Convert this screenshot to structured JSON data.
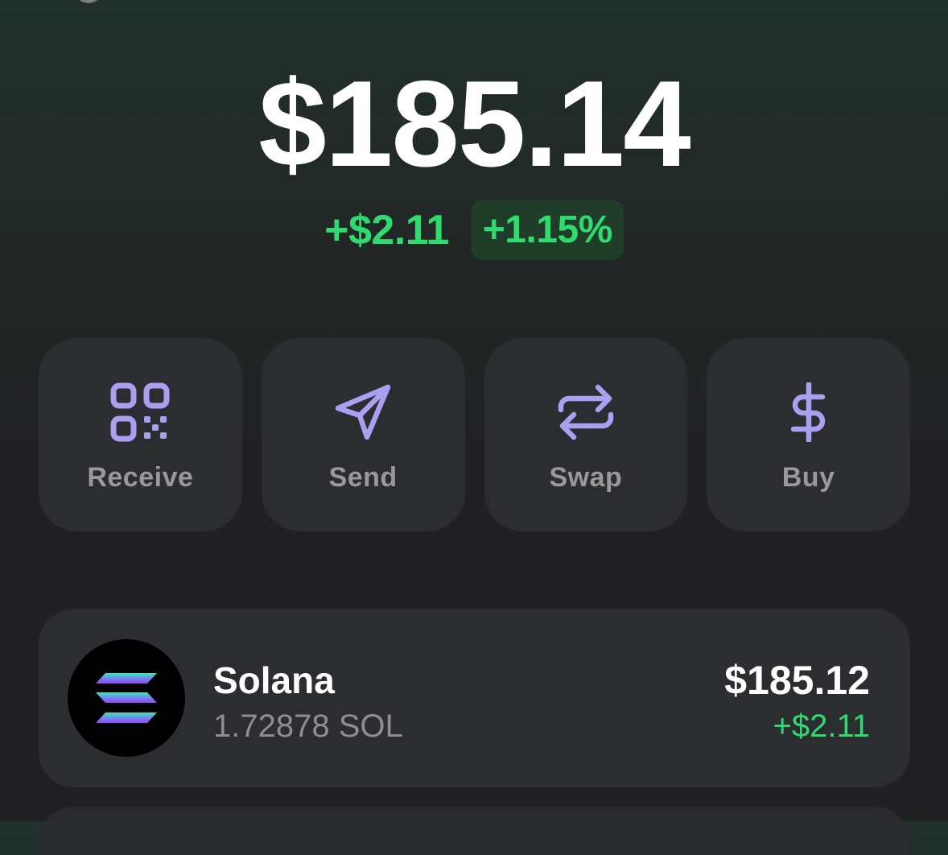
{
  "portfolio": {
    "balance": "$185.14",
    "change_amount": "+$2.11",
    "change_percent": "+1.15%"
  },
  "actions": [
    {
      "label": "Receive",
      "icon": "qr-code-icon"
    },
    {
      "label": "Send",
      "icon": "paper-plane-icon"
    },
    {
      "label": "Swap",
      "icon": "swap-arrows-icon"
    },
    {
      "label": "Buy",
      "icon": "dollar-icon"
    }
  ],
  "tokens": [
    {
      "name": "Solana",
      "amount": "1.72878 SOL",
      "value": "$185.12",
      "change": "+$2.11",
      "icon": "solana-logo-icon"
    }
  ],
  "colors": {
    "accent_purple": "#ab9ff2",
    "positive_green": "#2fdb6e",
    "card_bg": "#2c2d30",
    "label_gray": "#999999"
  }
}
